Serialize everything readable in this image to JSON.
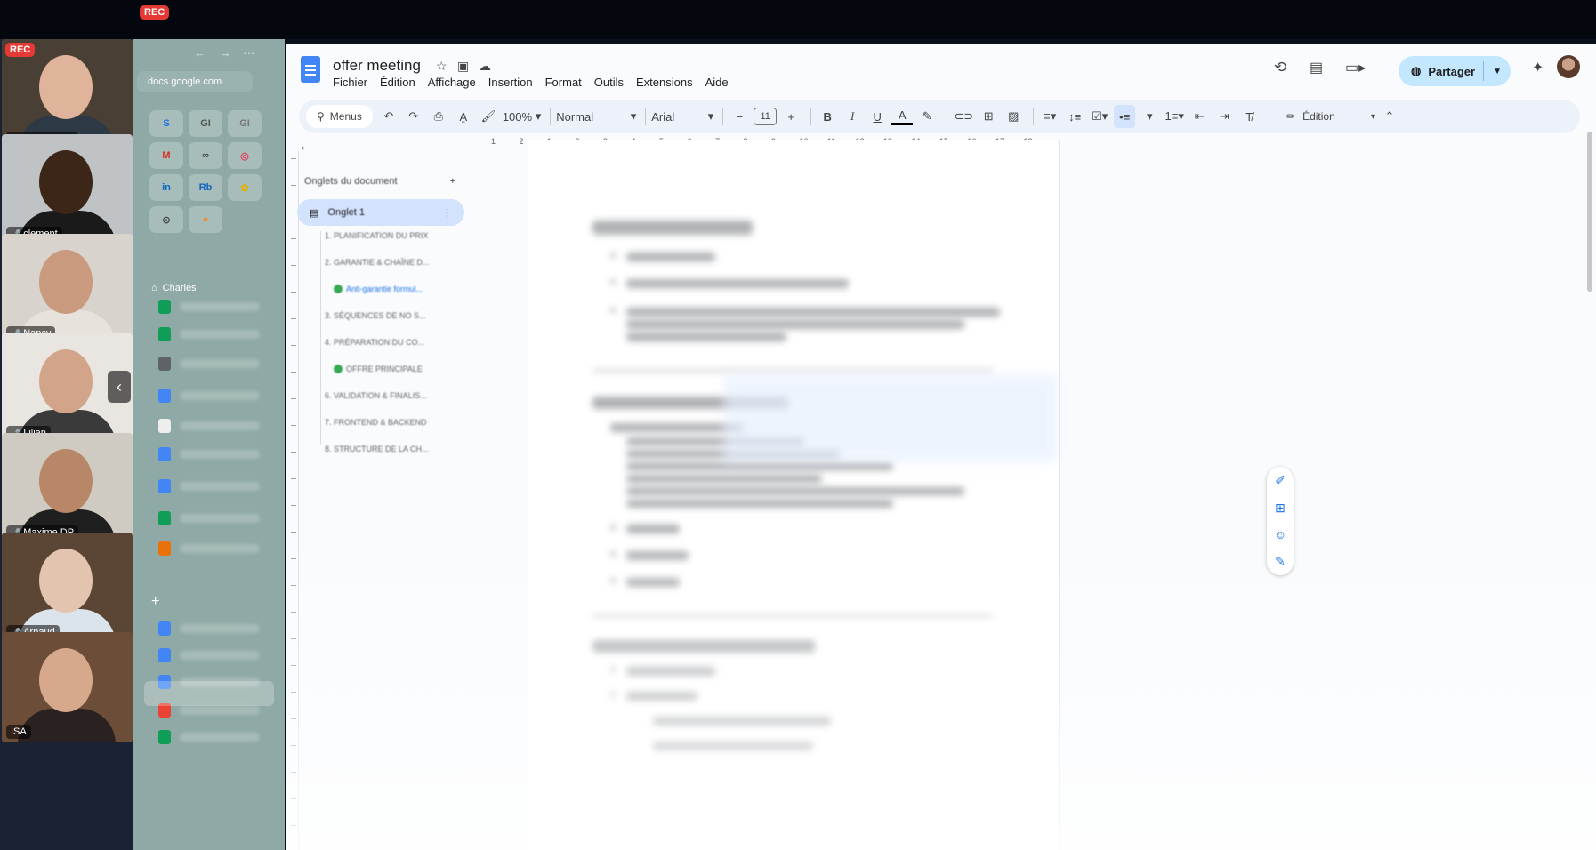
{
  "recording": {
    "badge": "REC"
  },
  "participants": [
    {
      "name": "Charles Baras",
      "muted": false,
      "active": true
    },
    {
      "name": "clement",
      "muted": true
    },
    {
      "name": "Nancy",
      "muted": true
    },
    {
      "name": "Lilian",
      "muted": true
    },
    {
      "name": "Maxime DP",
      "muted": true
    },
    {
      "name": "Arnaud",
      "muted": true
    },
    {
      "name": "ISA",
      "muted": false
    }
  ],
  "sidebar": {
    "url": "docs.google.com",
    "extensions": [
      "S",
      "GI",
      "GI",
      "M",
      "∞",
      "◎",
      "in",
      "Rb",
      "✿",
      "⊙",
      "●"
    ],
    "profile_label": "Charles",
    "new_label": "+"
  },
  "doc": {
    "title": "offer meeting",
    "menu": [
      "Fichier",
      "Édition",
      "Affichage",
      "Insertion",
      "Format",
      "Outils",
      "Extensions",
      "Aide"
    ],
    "share_label": "Partager",
    "toolbar": {
      "search_label": "Menus",
      "zoom": "100%",
      "style": "Normal",
      "font": "Arial",
      "font_size": "11",
      "mode": "Édition"
    },
    "ruler_ticks": [
      "1",
      "2",
      "1",
      "2",
      "3",
      "4",
      "5",
      "6",
      "7",
      "8",
      "9",
      "10",
      "11",
      "12",
      "13",
      "14",
      "15",
      "16",
      "17",
      "18"
    ],
    "outline": {
      "header": "Onglets du document",
      "tab": "Onglet 1",
      "items": [
        "1. PLANIFICATION DU PRIX",
        "2. GARANTIE & CHAÎNE D...",
        "Anti-garantie formul...",
        "3. SÉQUENCES DE NO S...",
        "4. PRÉPARATION DU CO...",
        "OFFRE PRINCIPALE",
        "6. VALIDATION & FINALIS...",
        "7. FRONTEND & BACKEND",
        "8. STRUCTURE DE LA CH..."
      ]
    }
  },
  "colors": {
    "accent": "#4285f4",
    "share_bg": "#c2e7ff",
    "rec": "#e53935",
    "active_tile": "#3ddc97"
  }
}
